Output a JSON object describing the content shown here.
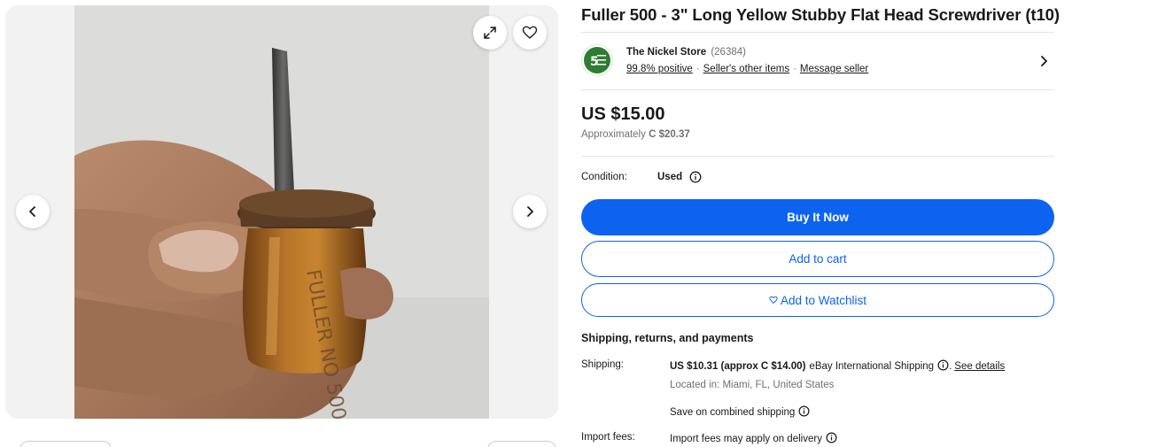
{
  "gallery": {
    "image_alt": "Hand holding a stubby yellow-handled flat head screwdriver",
    "handle_text": "FULLER NO 500",
    "icons": {
      "prev": "chevron-left-icon",
      "next": "chevron-right-icon",
      "expand": "expand-icon",
      "favorite": "heart-icon"
    }
  },
  "listing": {
    "title": "Fuller 500 - 3\" Long Yellow Stubby Flat Head Screwdriver (t10)"
  },
  "seller": {
    "name": "The Nickel Store",
    "feedback_count": "(26384)",
    "positive": "99.8% positive",
    "other_items": "Seller's other items",
    "message": "Message seller",
    "separator": "·"
  },
  "price": {
    "main": "US $15.00",
    "approx_prefix": "Approximately",
    "approx_value": "C $20.37"
  },
  "condition": {
    "label": "Condition:",
    "value": "Used"
  },
  "actions": {
    "buy_now": "Buy It Now",
    "add_to_cart": "Add to cart",
    "add_to_watchlist": "Add to Watchlist"
  },
  "shipping": {
    "section_title": "Shipping, returns, and payments",
    "shipping_label": "Shipping:",
    "shipping_cost": "US $10.31 (approx C $14.00)",
    "shipping_service": "eBay International Shipping",
    "period": ".",
    "see_details": "See details",
    "location": "Located in: Miami, FL, United States",
    "combined": "Save on combined shipping",
    "import_label": "Import fees:",
    "import_value": "Import fees may apply on delivery"
  },
  "colors": {
    "accent": "#0d63f0",
    "text": "#191919",
    "muted": "#707070",
    "divider": "#e5e5e5",
    "handle_amber": "#a8661c"
  }
}
